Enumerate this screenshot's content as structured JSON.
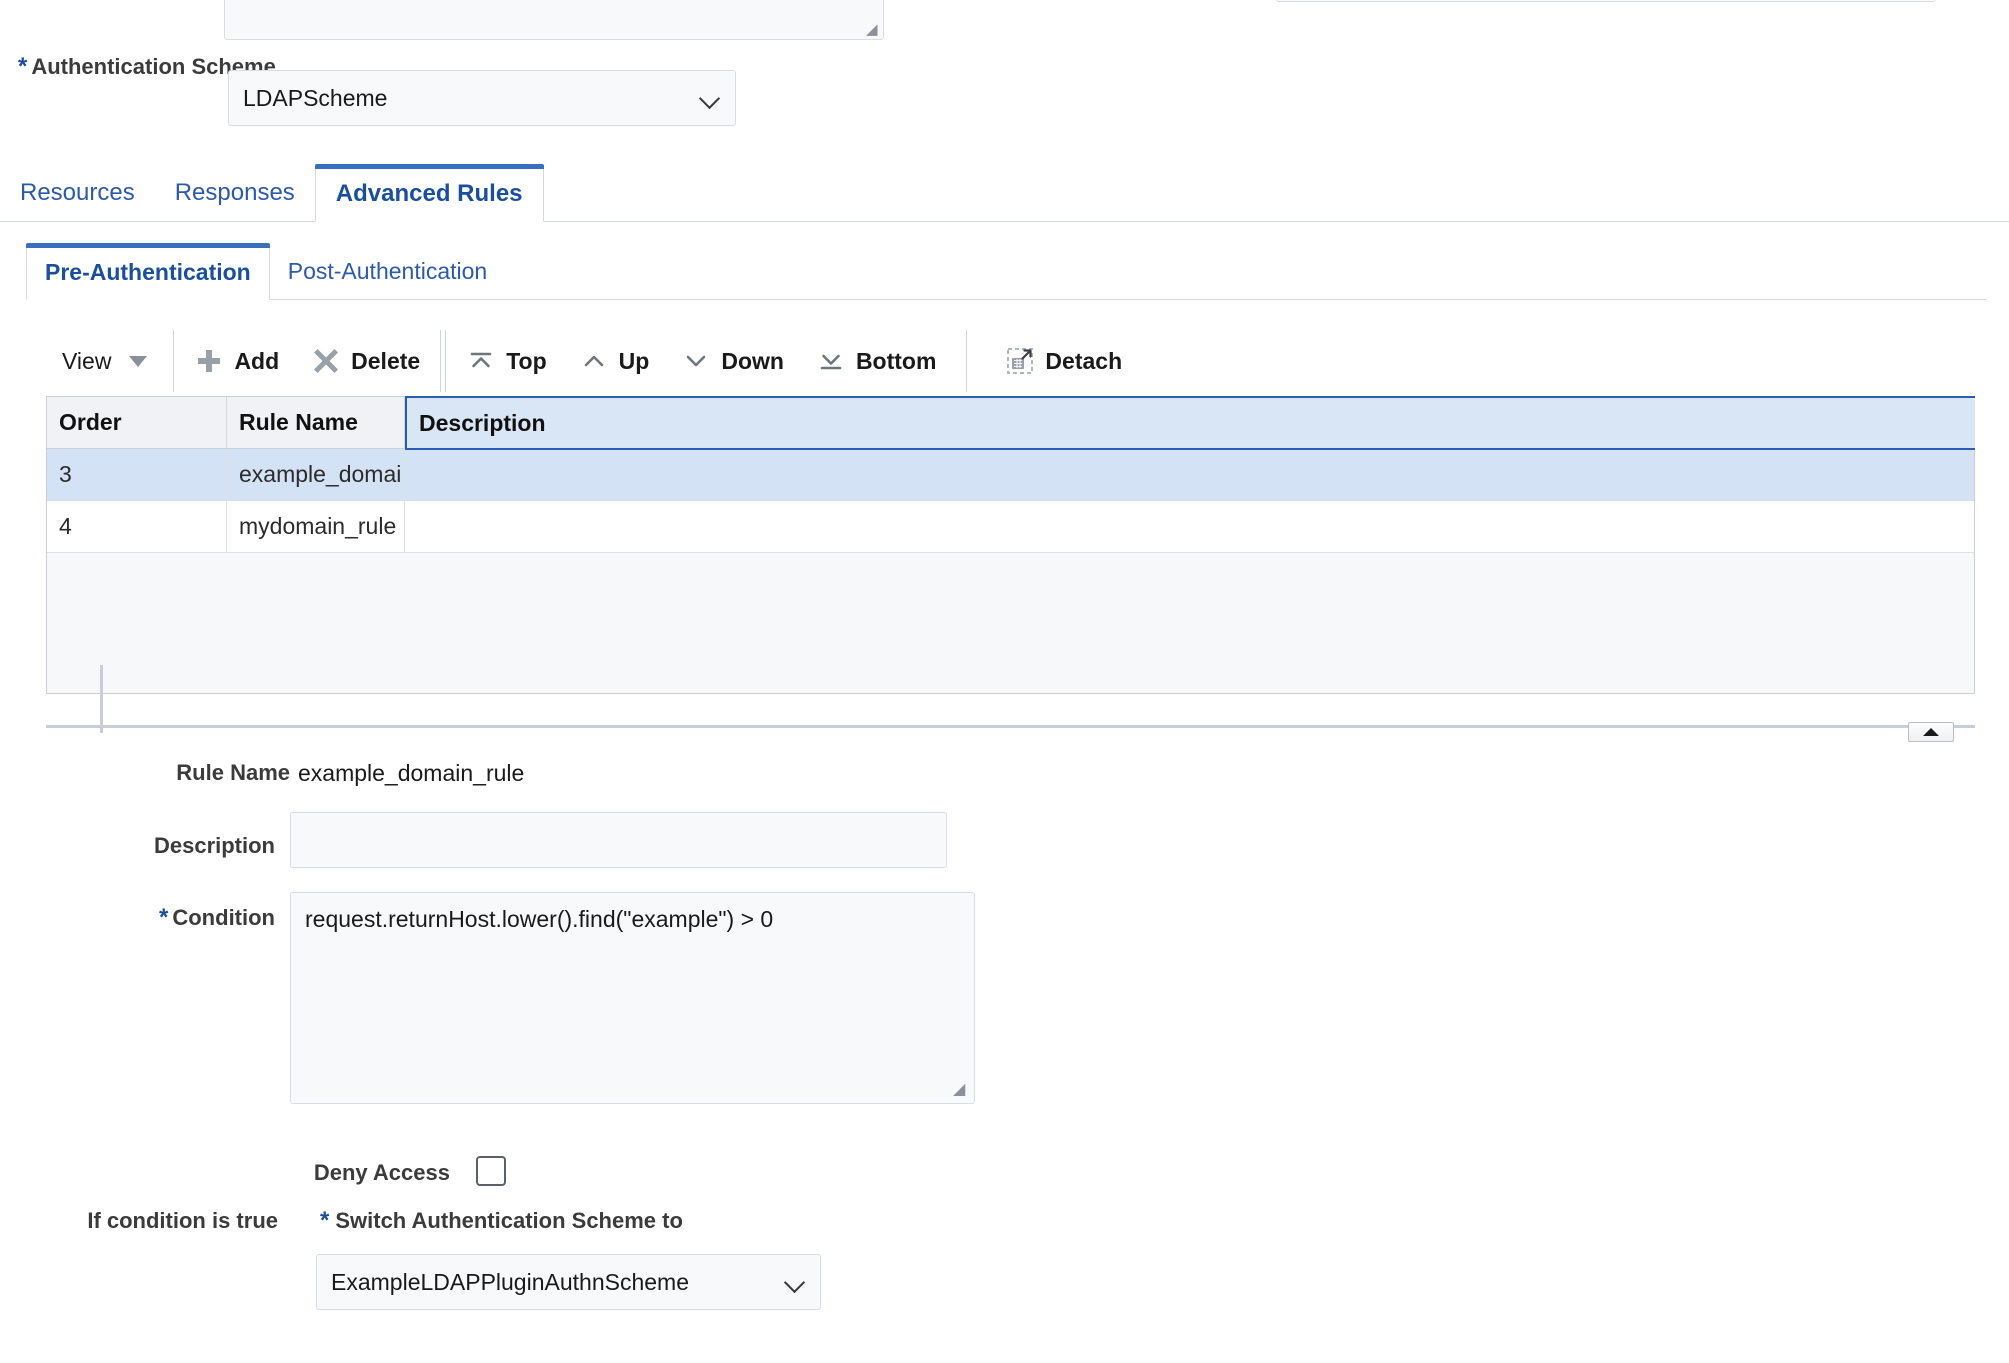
{
  "form_top": {
    "auth_scheme_label": "Authentication Scheme",
    "auth_scheme_value": "LDAPScheme",
    "required_marker": "*"
  },
  "tabs_primary": {
    "items": [
      {
        "label": "Resources",
        "active": false
      },
      {
        "label": "Responses",
        "active": false
      },
      {
        "label": "Advanced Rules",
        "active": true
      }
    ]
  },
  "tabs_secondary": {
    "items": [
      {
        "label": "Pre-Authentication",
        "active": true
      },
      {
        "label": "Post-Authentication",
        "active": false
      }
    ]
  },
  "toolbar": {
    "view_label": "View",
    "add_label": "Add",
    "delete_label": "Delete",
    "top_label": "Top",
    "up_label": "Up",
    "down_label": "Down",
    "bottom_label": "Bottom",
    "detach_label": "Detach"
  },
  "table": {
    "columns": [
      "Order",
      "Rule Name",
      "Description"
    ],
    "rows": [
      {
        "order": "3",
        "rule_name": "example_domai…",
        "description": "",
        "selected": true
      },
      {
        "order": "4",
        "rule_name": "mydomain_rule",
        "description": "",
        "selected": false
      }
    ]
  },
  "detail": {
    "rule_name_label": "Rule Name",
    "rule_name_value": "example_domain_rule",
    "description_label": "Description",
    "description_value": "",
    "condition_label": "Condition",
    "condition_value": "request.returnHost.lower().find(\"example\") > 0",
    "deny_access_label": "Deny Access",
    "deny_access_checked": false,
    "if_condition_label": "If condition is true",
    "switch_scheme_label": "Switch Authentication Scheme to",
    "switch_scheme_value": "ExampleLDAPPluginAuthnScheme",
    "required_marker": "*"
  },
  "colors": {
    "accent_blue": "#1a4f9c",
    "tab_indicator": "#3a6fbd",
    "row_selected": "#d3e3f5",
    "header_bg": "#f0f2f5",
    "field_bg": "#f8f9fb",
    "field_border": "#d9dde3",
    "selected_cell_border": "#2a5db0"
  }
}
